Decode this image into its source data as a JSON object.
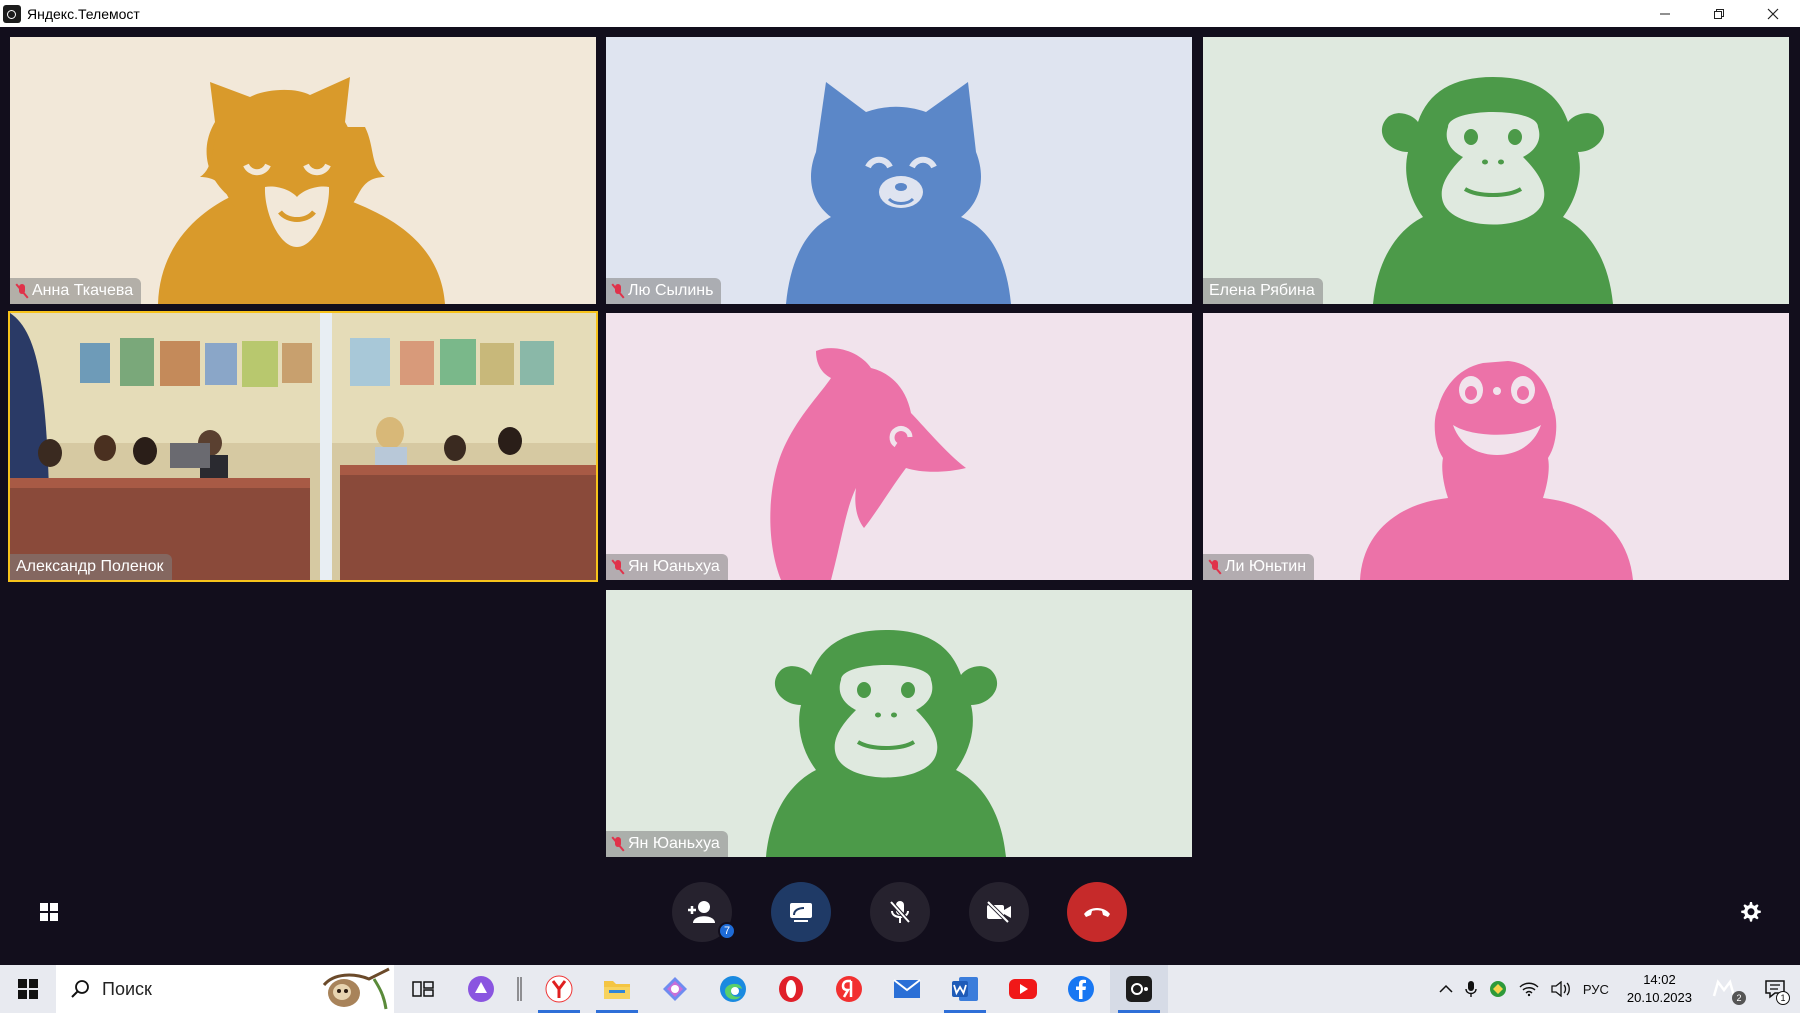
{
  "window": {
    "title": "Яндекс.Телемост"
  },
  "participants": [
    {
      "name": "Анна Ткачева",
      "avatar": "lion-icon",
      "muted": true,
      "bg": "#f2e8d9",
      "color": "#d99a2b"
    },
    {
      "name": "Лю Сылинь",
      "avatar": "cat-icon",
      "muted": true,
      "bg": "#dfe4f0",
      "color": "#5b87c8"
    },
    {
      "name": "Елена Рябина",
      "avatar": "monkey-icon",
      "muted": false,
      "bg": "#dfe9df",
      "color": "#4c9a49"
    },
    {
      "name": "Александр Поленок",
      "avatar": "camera-video",
      "muted": false,
      "active_speaker": true
    },
    {
      "name": "Ян Юаньхуа",
      "avatar": "dolphin-icon",
      "muted": true,
      "bg": "#f1e3ec",
      "color": "#ec72a8"
    },
    {
      "name": "Ли Юньтин",
      "avatar": "frog-icon",
      "muted": true,
      "bg": "#f1e3ec",
      "color": "#ec72a8"
    },
    {
      "name": "Ян Юаньхуа",
      "avatar": "monkey-icon",
      "muted": true,
      "bg": "#dfe9df",
      "color": "#4c9a49"
    }
  ],
  "toolbar": {
    "participants_count": "7",
    "buttons": [
      "grid-layout-icon",
      "add-participant-icon",
      "screen-share-icon",
      "mic-off-icon",
      "camera-off-icon",
      "hang-up-icon",
      "settings-icon"
    ],
    "hangup_color": "#c62a2a",
    "share_color": "#1f3a66"
  },
  "taskbar": {
    "search_placeholder": "Поиск",
    "language": "РУС",
    "time": "14:02",
    "date": "20.10.2023",
    "notification_count": "1",
    "tray_badge": "2"
  }
}
